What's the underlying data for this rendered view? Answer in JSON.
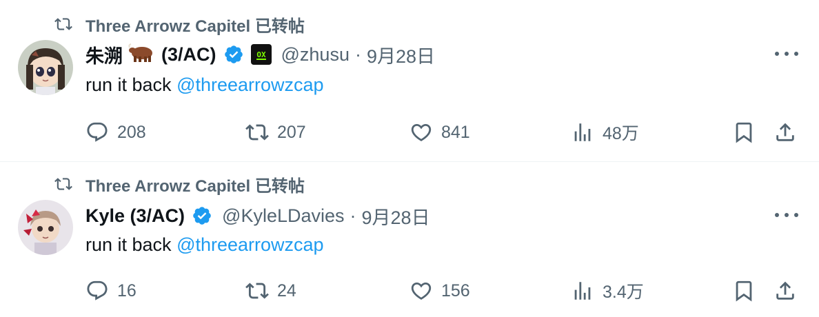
{
  "tweets": [
    {
      "retweeter": "Three Arrowz Capitel 已转帖",
      "name": "朱溯",
      "name_suffix": "(3/AC)",
      "handle": "@zhusu",
      "sep": "·",
      "date": "9月28日",
      "text": "run it back",
      "mention": "@threearrowzcap",
      "replies": "208",
      "reposts": "207",
      "likes": "841",
      "views": "48万"
    },
    {
      "retweeter": "Three Arrowz Capitel 已转帖",
      "name": "Kyle (3/AC)",
      "handle": "@KyleLDavies",
      "sep": "·",
      "date": "9月28日",
      "text": "run it back",
      "mention": "@threearrowzcap",
      "replies": "16",
      "reposts": "24",
      "likes": "156",
      "views": "3.4万"
    }
  ],
  "colors": {
    "secondary": "#536471",
    "link": "#1d9bf0",
    "verified": "#1d9bf0",
    "divider": "#eff3f4"
  },
  "icons": [
    "retweet-icon",
    "verified-icon",
    "ox-badge-icon",
    "more-icon",
    "reply-icon",
    "repost-icon",
    "like-icon",
    "views-icon",
    "bookmark-icon",
    "share-icon"
  ]
}
